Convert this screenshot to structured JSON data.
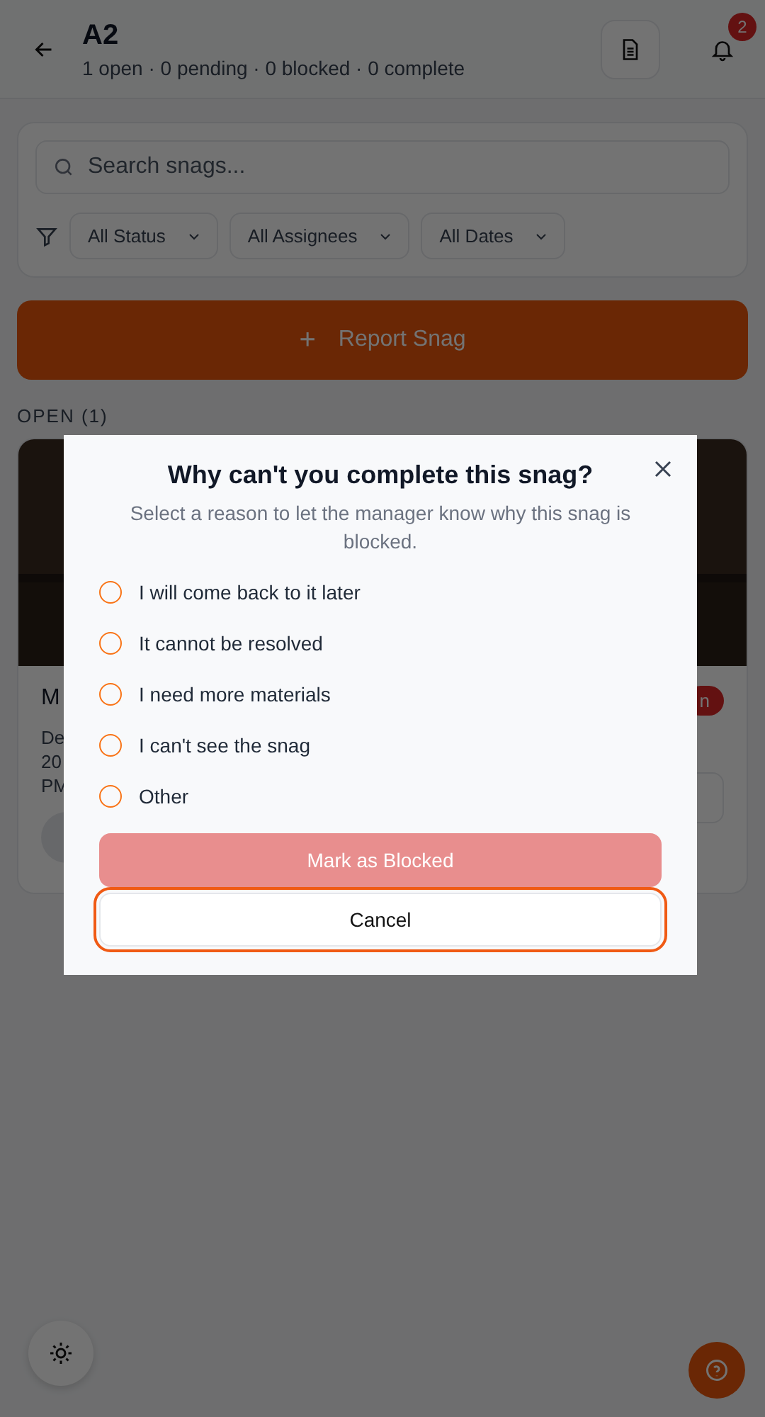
{
  "header": {
    "title": "A2",
    "subtitle": "1 open · 0 pending · 0 blocked · 0 complete",
    "notification_count": "2"
  },
  "search": {
    "placeholder": "Search snags..."
  },
  "filters": [
    {
      "label": "All Status"
    },
    {
      "label": "All Assignees"
    },
    {
      "label": "All Dates"
    }
  ],
  "report_button": {
    "label": "Report Snag",
    "icon": "+"
  },
  "section": {
    "title": "OPEN (1)"
  },
  "snag_card": {
    "title": "M",
    "meta_lines": [
      "De",
      "20",
      "PM"
    ],
    "badge": "n"
  },
  "dialog": {
    "title": "Why can't you complete this snag?",
    "description": "Select a reason to let the manager know why this snag is blocked.",
    "reasons": [
      {
        "label": "I will come back to it later",
        "selected": false
      },
      {
        "label": "It cannot be resolved",
        "selected": false
      },
      {
        "label": "I need more materials",
        "selected": false
      },
      {
        "label": "I can't see the snag",
        "selected": false
      },
      {
        "label": "Other",
        "selected": false
      }
    ],
    "primary": {
      "label": "Mark as Blocked",
      "disabled": true
    },
    "secondary": {
      "label": "Cancel",
      "focused": true
    }
  }
}
